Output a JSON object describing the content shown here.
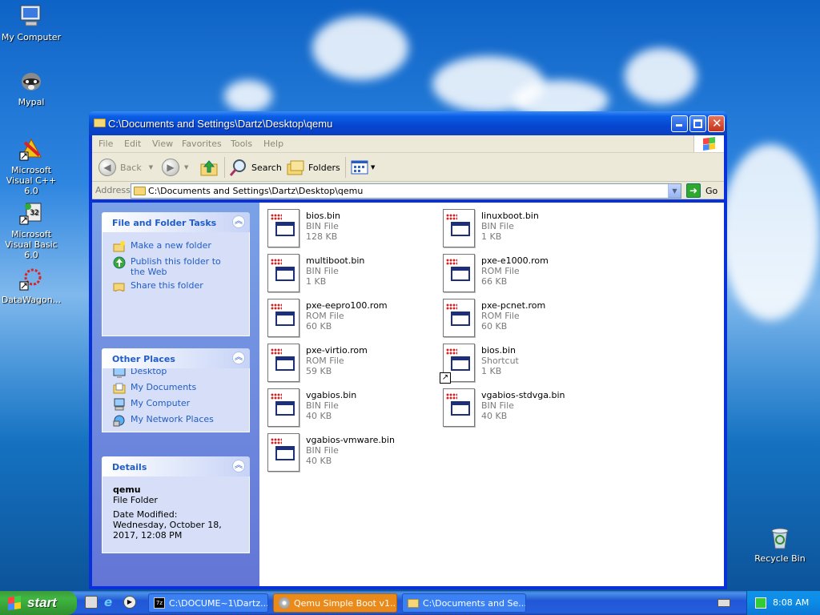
{
  "desktop": {
    "icons": [
      {
        "label": "My Computer"
      },
      {
        "label": "Mypal"
      },
      {
        "label": "Microsoft Visual C++ 6.0"
      },
      {
        "label": "Microsoft Visual Basic 6.0"
      },
      {
        "label": "DataWagon..."
      },
      {
        "label": "Recycle Bin"
      }
    ]
  },
  "window": {
    "title": "C:\\Documents and Settings\\Dartz\\Desktop\\qemu",
    "menu": [
      "File",
      "Edit",
      "View",
      "Favorites",
      "Tools",
      "Help"
    ],
    "toolbar": {
      "back": "Back",
      "search": "Search",
      "folders": "Folders"
    },
    "address": {
      "label": "Address",
      "value": "C:\\Documents and Settings\\Dartz\\Desktop\\qemu",
      "go": "Go"
    }
  },
  "sidebar": {
    "tasks": {
      "title": "File and Folder Tasks",
      "items": [
        "Make a new folder",
        "Publish this folder to the Web",
        "Share this folder"
      ]
    },
    "places": {
      "title": "Other Places",
      "items": [
        "Desktop",
        "My Documents",
        "My Computer",
        "My Network Places"
      ]
    },
    "details": {
      "title": "Details",
      "name": "qemu",
      "type": "File Folder",
      "modified": "Date Modified: Wednesday, October 18, 2017, 12:08 PM"
    }
  },
  "files": [
    {
      "name": "bios.bin",
      "type": "BIN File",
      "size": "128 KB"
    },
    {
      "name": "linuxboot.bin",
      "type": "BIN File",
      "size": "1 KB"
    },
    {
      "name": "multiboot.bin",
      "type": "BIN File",
      "size": "1 KB"
    },
    {
      "name": "pxe-e1000.rom",
      "type": "ROM File",
      "size": "66 KB"
    },
    {
      "name": "pxe-eepro100.rom",
      "type": "ROM File",
      "size": "60 KB"
    },
    {
      "name": "pxe-pcnet.rom",
      "type": "ROM File",
      "size": "60 KB"
    },
    {
      "name": "pxe-virtio.rom",
      "type": "ROM File",
      "size": "59 KB"
    },
    {
      "name": "bios.bin",
      "type": "Shortcut",
      "size": "1 KB"
    },
    {
      "name": "vgabios.bin",
      "type": "BIN File",
      "size": "40 KB"
    },
    {
      "name": "vgabios-stdvga.bin",
      "type": "BIN File",
      "size": "40 KB"
    },
    {
      "name": "vgabios-vmware.bin",
      "type": "BIN File",
      "size": "40 KB"
    }
  ],
  "taskbar": {
    "start": "start",
    "tasks": [
      "C:\\DOCUME~1\\Dartz...",
      "Qemu Simple Boot v1...",
      "C:\\Documents and Se..."
    ],
    "clock": "8:08 AM"
  }
}
